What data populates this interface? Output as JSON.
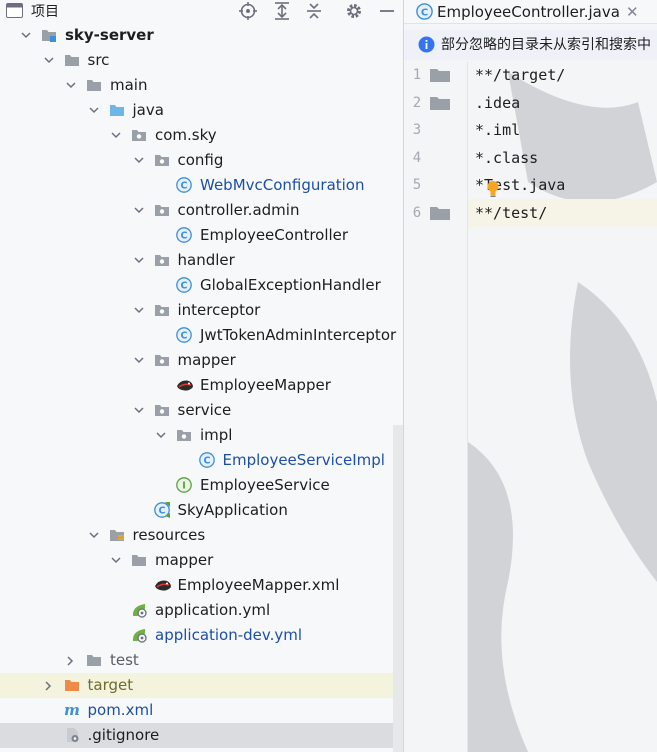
{
  "project_panel": {
    "title": "项目",
    "header_icons": [
      "crosshair-icon",
      "expand-all-icon",
      "collapse-all-icon",
      "gear-icon",
      "minimize-icon"
    ],
    "tree": [
      {
        "label": "sky-server",
        "icon": "module-folder-icon",
        "arrow": "down",
        "style": "bold"
      },
      {
        "label": "src",
        "icon": "folder-icon",
        "arrow": "down"
      },
      {
        "label": "main",
        "icon": "folder-icon",
        "arrow": "down"
      },
      {
        "label": "java",
        "icon": "source-folder-icon",
        "arrow": "down"
      },
      {
        "label": "com.sky",
        "icon": "package-icon",
        "arrow": "down"
      },
      {
        "label": "config",
        "icon": "package-icon",
        "arrow": "down"
      },
      {
        "label": "WebMvcConfiguration",
        "icon": "java-class-icon",
        "arrow": "none",
        "style": "blue"
      },
      {
        "label": "controller.admin",
        "icon": "package-icon",
        "arrow": "down"
      },
      {
        "label": "EmployeeController",
        "icon": "java-class-icon",
        "arrow": "none"
      },
      {
        "label": "handler",
        "icon": "package-icon",
        "arrow": "down"
      },
      {
        "label": "GlobalExceptionHandler",
        "icon": "java-class-icon",
        "arrow": "none"
      },
      {
        "label": "interceptor",
        "icon": "package-icon",
        "arrow": "down"
      },
      {
        "label": "JwtTokenAdminInterceptor",
        "icon": "java-class-icon",
        "arrow": "none"
      },
      {
        "label": "mapper",
        "icon": "package-icon",
        "arrow": "down"
      },
      {
        "label": "EmployeeMapper",
        "icon": "mybatis-icon",
        "arrow": "none"
      },
      {
        "label": "service",
        "icon": "package-icon",
        "arrow": "down"
      },
      {
        "label": "impl",
        "icon": "package-icon",
        "arrow": "down"
      },
      {
        "label": "EmployeeServiceImpl",
        "icon": "java-class-icon",
        "arrow": "none",
        "style": "blue"
      },
      {
        "label": "EmployeeService",
        "icon": "java-interface-icon",
        "arrow": "none"
      },
      {
        "label": "SkyApplication",
        "icon": "spring-boot-class-icon",
        "arrow": "none"
      },
      {
        "label": "resources",
        "icon": "resources-folder-icon",
        "arrow": "down"
      },
      {
        "label": "mapper",
        "icon": "folder-icon",
        "arrow": "down"
      },
      {
        "label": "EmployeeMapper.xml",
        "icon": "mybatis-icon",
        "arrow": "none"
      },
      {
        "label": "application.yml",
        "icon": "spring-config-icon",
        "arrow": "none"
      },
      {
        "label": "application-dev.yml",
        "icon": "spring-config-icon",
        "arrow": "none",
        "style": "blue"
      },
      {
        "label": "test",
        "icon": "folder-icon",
        "arrow": "right",
        "style": "dim"
      },
      {
        "label": "target",
        "icon": "excluded-folder-icon",
        "arrow": "right",
        "style": "olive"
      },
      {
        "label": "pom.xml",
        "icon": "maven-icon",
        "arrow": "none",
        "style": "blue"
      },
      {
        "label": ".gitignore",
        "icon": "gitignore-icon",
        "arrow": "none"
      }
    ]
  },
  "editor": {
    "tab_label": "EmployeeController.java",
    "tab_icon": "java-class-icon",
    "notice": "部分忽略的目录未从索引和搜索中",
    "lines": [
      {
        "num": "1",
        "text": "**/target/",
        "folder_icon": true
      },
      {
        "num": "2",
        "text": ".idea",
        "folder_icon": true
      },
      {
        "num": "3",
        "text": "*.iml",
        "folder_icon": false
      },
      {
        "num": "4",
        "text": "*.class",
        "folder_icon": false
      },
      {
        "num": "5",
        "text": "*Test.java",
        "folder_icon": false
      },
      {
        "num": "6",
        "text": "**/test/",
        "folder_icon": true
      }
    ]
  },
  "colors": {
    "accent_blue": "#1d4ea9",
    "class_icon": "#3d8fd8",
    "interface_icon": "#5aa13b",
    "folder": "#9aa0a8",
    "excluded_folder": "#f08a4b",
    "highlight_row": "#f3f3de",
    "selected_row": "#dadcdf"
  }
}
